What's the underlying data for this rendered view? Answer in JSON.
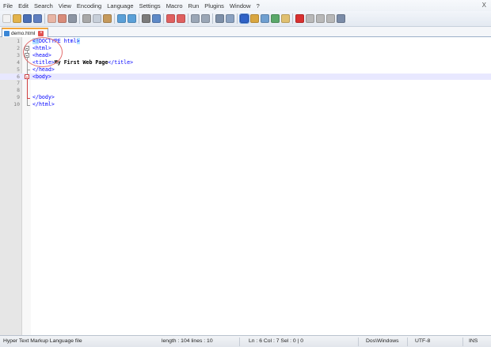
{
  "menubar": {
    "items": [
      "File",
      "Edit",
      "Search",
      "View",
      "Encoding",
      "Language",
      "Settings",
      "Macro",
      "Run",
      "Plugins",
      "Window",
      "?"
    ],
    "close_label": "X"
  },
  "toolbar": {
    "icons": [
      {
        "name": "new-file-icon",
        "color": "#f2f2f2"
      },
      {
        "name": "open-file-icon",
        "color": "#e3b34b"
      },
      {
        "name": "save-icon",
        "color": "#4a6fb5"
      },
      {
        "name": "save-all-icon",
        "color": "#5f7fc0"
      },
      {
        "name": "close-icon",
        "color": "#e8b5a5"
      },
      {
        "name": "close-all-icon",
        "color": "#d98c7a"
      },
      {
        "name": "print-icon",
        "color": "#8c95a3"
      },
      {
        "name": "cut-icon",
        "color": "#a8a8a8"
      },
      {
        "name": "copy-icon",
        "color": "#c7cfd9"
      },
      {
        "name": "paste-icon",
        "color": "#c59a5c"
      },
      {
        "name": "undo-icon",
        "color": "#5aa0d8"
      },
      {
        "name": "redo-icon",
        "color": "#5aa0d8"
      },
      {
        "name": "find-icon",
        "color": "#7b7b7b"
      },
      {
        "name": "replace-icon",
        "color": "#5d89c7"
      },
      {
        "name": "zoom-in-icon",
        "color": "#e06060"
      },
      {
        "name": "zoom-out-icon",
        "color": "#e06060"
      },
      {
        "name": "sync-vertical-icon",
        "color": "#9aa6b6"
      },
      {
        "name": "sync-horizontal-icon",
        "color": "#9aa6b6"
      },
      {
        "name": "word-wrap-icon",
        "color": "#7d8fa8"
      },
      {
        "name": "show-all-chars-icon",
        "color": "#8aa1c0"
      },
      {
        "name": "indent-guide-icon",
        "color": "#2f62c8",
        "selected": true
      },
      {
        "name": "user-defined-language-icon",
        "color": "#d9a640"
      },
      {
        "name": "document-map-icon",
        "color": "#6f9fd0"
      },
      {
        "name": "function-list-icon",
        "color": "#5aa86a"
      },
      {
        "name": "folder-as-workspace-icon",
        "color": "#e0c070"
      },
      {
        "name": "record-macro-icon",
        "color": "#d83030"
      },
      {
        "name": "stop-recording-icon",
        "color": "#b8b8b8"
      },
      {
        "name": "playback-macro-icon",
        "color": "#b8b8b8"
      },
      {
        "name": "run-macro-multiple-icon",
        "color": "#b8b8b8"
      },
      {
        "name": "save-macro-icon",
        "color": "#7b8ca8"
      }
    ],
    "separators_after": [
      3,
      6,
      9,
      11,
      13,
      15,
      17,
      19,
      24
    ]
  },
  "tabs": [
    {
      "label": "demo.html",
      "active": true
    }
  ],
  "editor": {
    "lines": [
      {
        "num": "1",
        "html": "<span class=\"doctype\">&lt;!</span><span class=\"tag\">DOCTYPE html</span><span class=\"doctype\">&gt;</span>"
      },
      {
        "num": "2",
        "html": "<span class=\"tag\">&lt;html&gt;</span>"
      },
      {
        "num": "3",
        "html": "<span class=\"tag\">&lt;head&gt;</span>"
      },
      {
        "num": "4",
        "html": "<span class=\"tag\">&lt;title&gt;</span><span class=\"bold\">My First Web Page</span><span class=\"tag\">&lt;/title&gt;</span>"
      },
      {
        "num": "5",
        "html": "<span class=\"tag\">&lt;/head&gt;</span>"
      },
      {
        "num": "6",
        "html": "<span class=\"tag\">&lt;body&gt;</span>",
        "current": true
      },
      {
        "num": "7",
        "html": ""
      },
      {
        "num": "8",
        "html": ""
      },
      {
        "num": "9",
        "html": "<span class=\"tag\">&lt;/body&gt;</span>"
      },
      {
        "num": "10",
        "html": "<span class=\"tag\">&lt;/html&gt;</span>"
      }
    ]
  },
  "statusbar": {
    "file_type": "Hyper Text Markup Language file",
    "length_lines": "length : 104   lines : 10",
    "position": "Ln : 6   Col : 7   Sel : 0 | 0",
    "eol": "Dos\\Windows",
    "encoding": "UTF-8",
    "mode": "INS"
  }
}
